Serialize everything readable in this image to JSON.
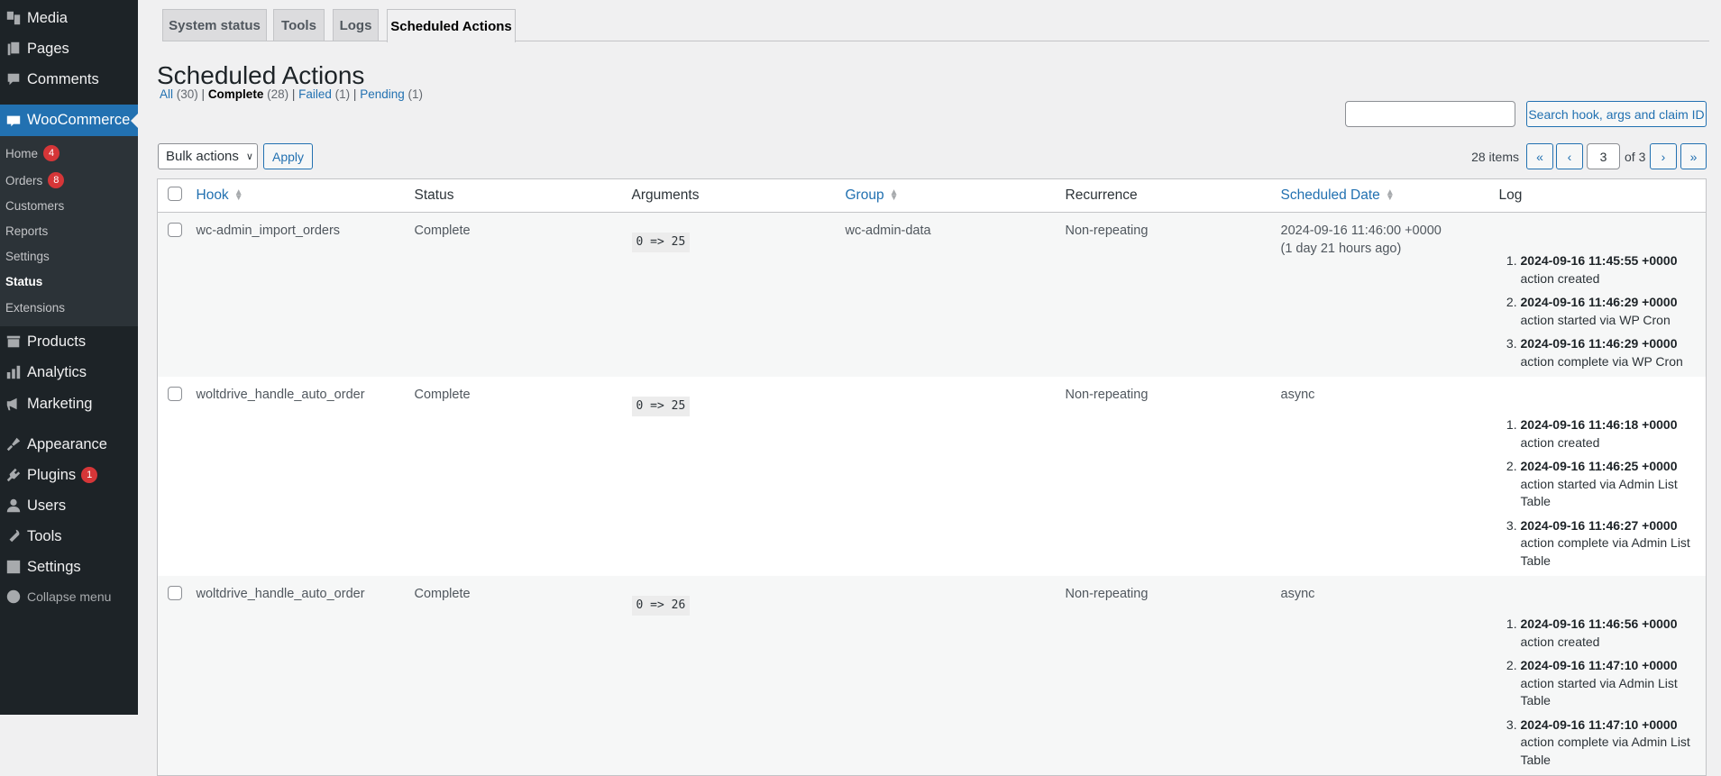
{
  "sidebar": {
    "top_items": [
      {
        "label": "Media",
        "icon": "media-icon"
      },
      {
        "label": "Pages",
        "icon": "pages-icon"
      },
      {
        "label": "Comments",
        "icon": "comments-icon"
      }
    ],
    "woocommerce": {
      "label": "WooCommerce",
      "icon": "woo-icon"
    },
    "submenu": [
      {
        "label": "Home",
        "badge": "4"
      },
      {
        "label": "Orders",
        "badge": "8"
      },
      {
        "label": "Customers"
      },
      {
        "label": "Reports"
      },
      {
        "label": "Settings"
      },
      {
        "label": "Status",
        "current": true
      },
      {
        "label": "Extensions"
      }
    ],
    "bottom_items": [
      {
        "label": "Products",
        "icon": "products-icon"
      },
      {
        "label": "Analytics",
        "icon": "analytics-icon"
      },
      {
        "label": "Marketing",
        "icon": "megaphone-icon"
      },
      {
        "label": "Appearance",
        "icon": "brush-icon"
      },
      {
        "label": "Plugins",
        "icon": "plugin-icon",
        "badge": "1"
      },
      {
        "label": "Users",
        "icon": "users-icon"
      },
      {
        "label": "Tools",
        "icon": "wrench-icon"
      },
      {
        "label": "Settings",
        "icon": "settings-icon"
      }
    ],
    "collapse": "Collapse menu"
  },
  "tabs": [
    {
      "label": "System status"
    },
    {
      "label": "Tools"
    },
    {
      "label": "Logs"
    },
    {
      "label": "Scheduled Actions",
      "active": true
    }
  ],
  "page": {
    "title": "Scheduled Actions"
  },
  "filters": [
    {
      "label": "All",
      "count": "(30)"
    },
    {
      "label": "Complete",
      "count": "(28)",
      "current": true
    },
    {
      "label": "Failed",
      "count": "(1)"
    },
    {
      "label": "Pending",
      "count": "(1)"
    }
  ],
  "search": {
    "value": "",
    "button": "Search hook, args and claim ID"
  },
  "bulk": {
    "selected": "Bulk actions",
    "apply": "Apply"
  },
  "pagination": {
    "items": "28 items",
    "first": "«",
    "prev": "‹",
    "current": "3",
    "of": "of 3",
    "next": "›",
    "last": "»"
  },
  "table": {
    "columns": [
      "Hook",
      "Status",
      "Arguments",
      "Group",
      "Recurrence",
      "Scheduled Date",
      "Log"
    ],
    "rows": [
      {
        "hook": "wc-admin_import_orders",
        "status": "Complete",
        "args": "0 => 25",
        "group": "wc-admin-data",
        "recurrence": "Non-repeating",
        "date": "2024-09-16 11:46:00 +0000",
        "date_rel": "(1 day 21 hours ago)",
        "log": [
          {
            "time": "2024-09-16 11:45:55 +0000",
            "msg": "action created"
          },
          {
            "time": "2024-09-16 11:46:29 +0000",
            "msg": "action started via WP Cron"
          },
          {
            "time": "2024-09-16 11:46:29 +0000",
            "msg": "action complete via WP Cron"
          }
        ]
      },
      {
        "hook": "woltdrive_handle_auto_order",
        "status": "Complete",
        "args": "0 => 25",
        "group": "",
        "recurrence": "Non-repeating",
        "date": "async",
        "date_rel": "",
        "log": [
          {
            "time": "2024-09-16 11:46:18 +0000",
            "msg": "action created"
          },
          {
            "time": "2024-09-16 11:46:25 +0000",
            "msg": "action started via Admin List Table"
          },
          {
            "time": "2024-09-16 11:46:27 +0000",
            "msg": "action complete via Admin List Table"
          }
        ]
      },
      {
        "hook": "woltdrive_handle_auto_order",
        "status": "Complete",
        "args": "0 => 26",
        "group": "",
        "recurrence": "Non-repeating",
        "date": "async",
        "date_rel": "",
        "log": [
          {
            "time": "2024-09-16 11:46:56 +0000",
            "msg": "action created"
          },
          {
            "time": "2024-09-16 11:47:10 +0000",
            "msg": "action started via Admin List Table"
          },
          {
            "time": "2024-09-16 11:47:10 +0000",
            "msg": "action complete via Admin List Table"
          }
        ]
      }
    ]
  },
  "colors": {
    "accent": "#2271b1",
    "sidebar": "#1d2327",
    "badge": "#d63638"
  }
}
